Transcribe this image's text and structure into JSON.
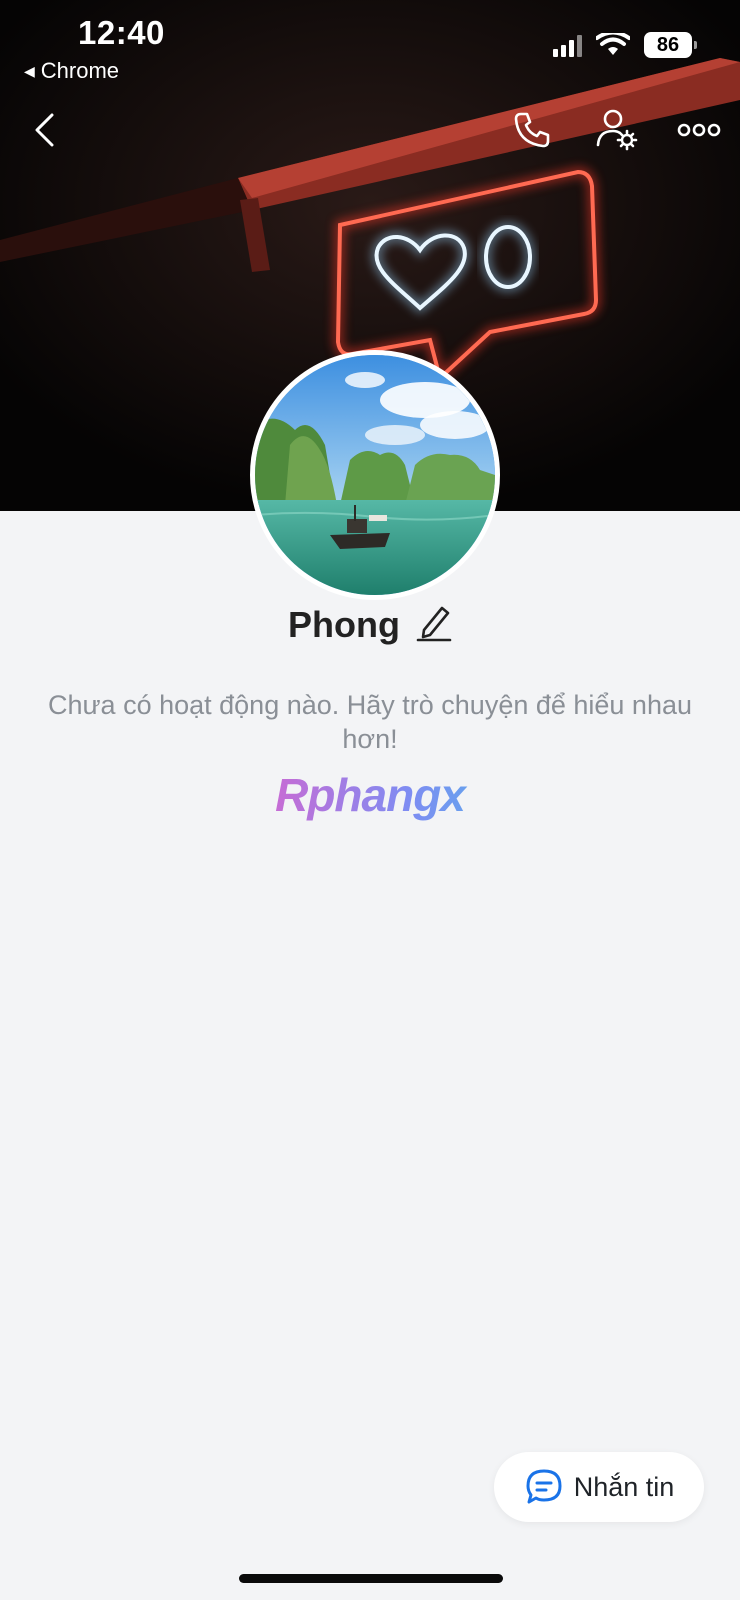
{
  "status_bar": {
    "time": "12:40",
    "back_app": "Chrome",
    "battery": "86"
  },
  "nav": {
    "back_icon": "chevron-left-icon",
    "call_icon": "phone-icon",
    "settings_icon": "user-settings-icon",
    "more_icon": "more-horizontal-icon"
  },
  "profile": {
    "name": "Phong",
    "edit_icon": "pencil-icon",
    "empty_message": "Chưa có hoạt động nào. Hãy trò chuyện để hiểu nhau hơn!",
    "watermark": "Rphangx"
  },
  "actions": {
    "message_label": "Nhắn tin",
    "message_icon": "chat-bubble-icon"
  },
  "colors": {
    "accent_blue": "#1a73e8",
    "background": "#f3f4f6"
  }
}
